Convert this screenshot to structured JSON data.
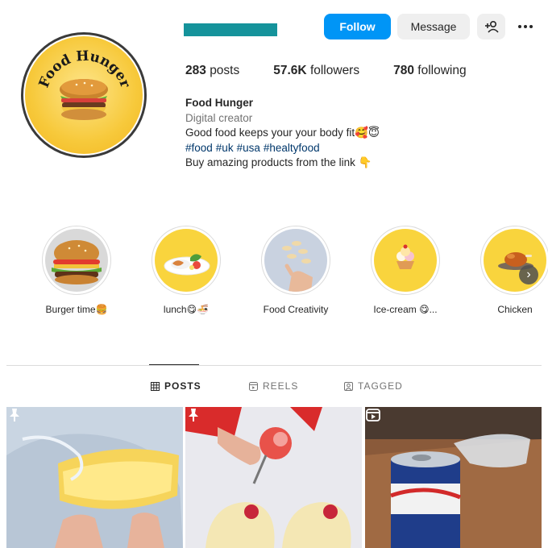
{
  "profile": {
    "follow_label": "Follow",
    "message_label": "Message",
    "avatar_text": "Food Hunger",
    "stats": [
      {
        "value": "283",
        "label": "posts"
      },
      {
        "value": "57.6K",
        "label": "followers"
      },
      {
        "value": "780",
        "label": "following"
      }
    ],
    "bio": {
      "name": "Food Hunger",
      "category": "Digital creator",
      "line1": "Good food keeps your your body fit🥰😇",
      "hashtags": [
        "#food",
        "#uk",
        "#usa",
        "#healtyfood"
      ],
      "line3": "Buy amazing products from the link 👇"
    }
  },
  "highlights": [
    {
      "label": "Burger time🍔"
    },
    {
      "label": "lunch😋🍜"
    },
    {
      "label": "Food Creativity"
    },
    {
      "label": "Ice-cream 😋..."
    },
    {
      "label": "Chicken"
    }
  ],
  "tabs": [
    {
      "label": "POSTS",
      "active": true
    },
    {
      "label": "REELS",
      "active": false
    },
    {
      "label": "TAGGED",
      "active": false
    }
  ],
  "colors": {
    "follow_button": "#0095f6",
    "username_bar": "#15939b",
    "highlight_yellow": "#f9d43d",
    "hashtag": "#00376b"
  }
}
